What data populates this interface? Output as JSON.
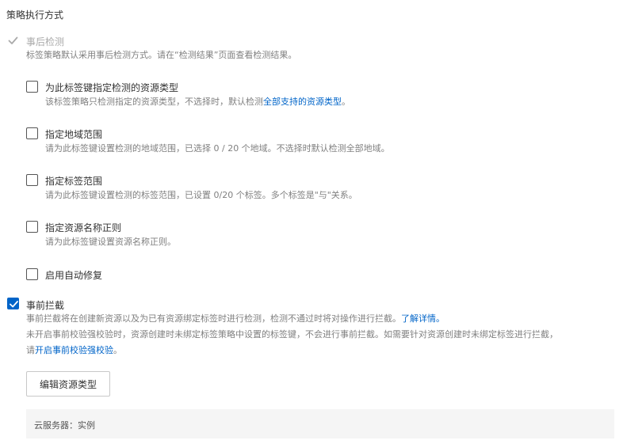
{
  "section_title": "策略执行方式",
  "post_check": {
    "label": "事后检测",
    "checked": true,
    "disabled": true,
    "desc": "标签策略默认采用事后检测方式。请在“检测结果”页面查看检测结果。"
  },
  "options": [
    {
      "label": "为此标签键指定检测的资源类型",
      "checked": false,
      "desc_prefix": "该标签策略只检测指定的资源类型，不选择时，默认检测",
      "desc_link": "全部支持的资源类型",
      "desc_suffix": "。"
    },
    {
      "label": "指定地域范围",
      "checked": false,
      "desc": "请为此标签键设置检测的地域范围，已选择 0 / 20 个地域。不选择时默认检测全部地域。"
    },
    {
      "label": "指定标签范围",
      "checked": false,
      "desc": "请为此标签键设置检测的标签范围，已设置 0/20 个标签。多个标签是\"与\"关系。"
    },
    {
      "label": "指定资源名称正则",
      "checked": false,
      "desc": "请为此标签键设置资源名称正则。"
    },
    {
      "label": "启用自动修复",
      "checked": false
    }
  ],
  "pre_check": {
    "label": "事前拦截",
    "checked": true,
    "desc_line1_prefix": "事前拦截将在创建新资源以及为已有资源绑定标签时进行检测，检测不通过时将对操作进行拦截。",
    "desc_line1_link": "了解详情。",
    "desc_line2": "未开启事前校验强校验时，资源创建时未绑定标签策略中设置的标签键，不会进行事前拦截。如需要针对资源创建时未绑定标签进行拦截，",
    "desc_line3_prefix": "请",
    "desc_line3_link": "开启事前校验强校验",
    "desc_line3_suffix": "。"
  },
  "edit_button_label": "编辑资源类型",
  "resource_panel_text": "云服务器：实例",
  "colors": {
    "accent": "#0064c8",
    "disabled_text": "#aaaaaa",
    "desc_text": "#808080",
    "panel_bg": "#f5f5f5"
  }
}
